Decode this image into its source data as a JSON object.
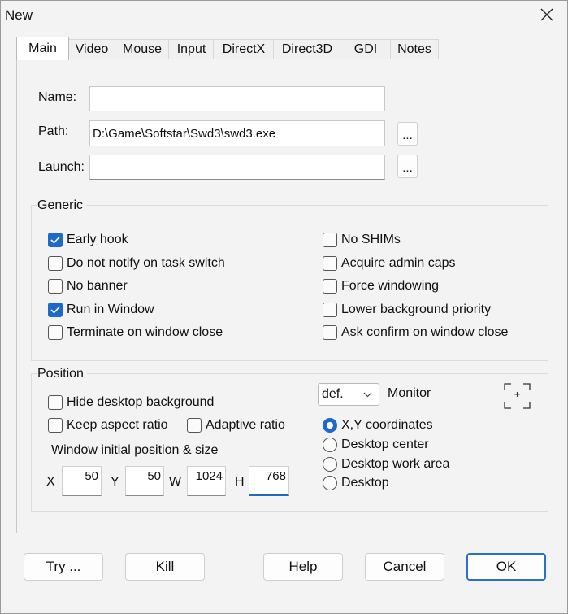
{
  "window": {
    "title": "New"
  },
  "tabs": [
    "Main",
    "Video",
    "Mouse",
    "Input",
    "DirectX",
    "Direct3D",
    "GDI",
    "Notes"
  ],
  "fields": {
    "name": {
      "label": "Name:",
      "value": ""
    },
    "path": {
      "label": "Path:",
      "value": "D:\\Game\\Softstar\\Swd3\\swd3.exe",
      "browse": "..."
    },
    "launch": {
      "label": "Launch:",
      "value": "",
      "browse": "..."
    }
  },
  "generic": {
    "title": "Generic",
    "left": [
      {
        "label": "Early hook",
        "checked": true
      },
      {
        "label": "Do not notify on task switch",
        "checked": false
      },
      {
        "label": "No banner",
        "checked": false
      },
      {
        "label": "Run in Window",
        "checked": true
      },
      {
        "label": "Terminate on window close",
        "checked": false
      }
    ],
    "right": [
      {
        "label": "No SHIMs",
        "checked": false
      },
      {
        "label": "Acquire admin caps",
        "checked": false
      },
      {
        "label": "Force windowing",
        "checked": false
      },
      {
        "label": "Lower background priority",
        "checked": false
      },
      {
        "label": "Ask confirm on window close",
        "checked": false
      }
    ]
  },
  "position": {
    "title": "Position",
    "hide_desktop": {
      "label": "Hide desktop background",
      "checked": false
    },
    "keep_aspect": {
      "label": "Keep aspect ratio",
      "checked": false
    },
    "adaptive": {
      "label": "Adaptive ratio",
      "checked": false
    },
    "initial_label": "Window initial position & size",
    "x": {
      "label": "X",
      "value": "50"
    },
    "y": {
      "label": "Y",
      "value": "50"
    },
    "w": {
      "label": "W",
      "value": "1024"
    },
    "h": {
      "label": "H",
      "value": "768"
    },
    "monitor": {
      "selected": "def.",
      "label": "Monitor"
    },
    "radios": [
      {
        "label": "X,Y coordinates",
        "checked": true
      },
      {
        "label": "Desktop center",
        "checked": false
      },
      {
        "label": "Desktop work area",
        "checked": false
      },
      {
        "label": "Desktop",
        "checked": false
      }
    ]
  },
  "buttons": {
    "try": "Try ...",
    "kill": "Kill",
    "help": "Help",
    "cancel": "Cancel",
    "ok": "OK"
  },
  "colors": {
    "accent": "#1d6ac8"
  }
}
